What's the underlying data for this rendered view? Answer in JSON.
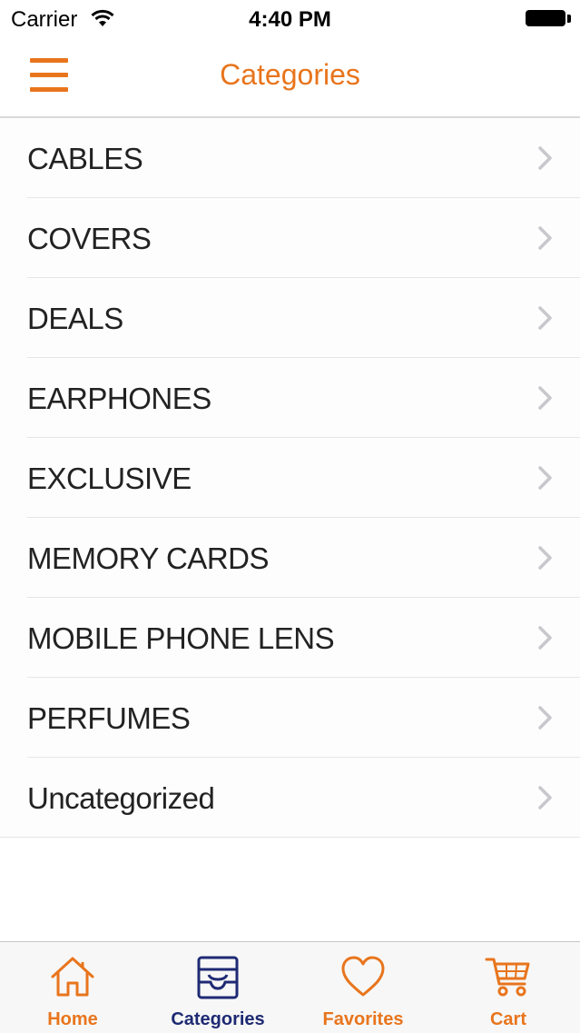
{
  "status_bar": {
    "carrier": "Carrier",
    "time": "4:40 PM"
  },
  "nav": {
    "title": "Categories"
  },
  "categories": [
    "CABLES",
    "COVERS",
    "DEALS",
    "EARPHONES",
    "EXCLUSIVE",
    "MEMORY CARDS",
    "MOBILE PHONE LENS",
    "PERFUMES",
    "Uncategorized"
  ],
  "tabs": [
    {
      "label": "Home",
      "icon": "home-icon",
      "active": false
    },
    {
      "label": "Categories",
      "icon": "tray-icon",
      "active": true
    },
    {
      "label": "Favorites",
      "icon": "heart-icon",
      "active": false
    },
    {
      "label": "Cart",
      "icon": "cart-icon",
      "active": false
    }
  ],
  "colors": {
    "accent": "#e8751d",
    "active_tab": "#1e2a73",
    "chevron": "#c7c7cc"
  }
}
